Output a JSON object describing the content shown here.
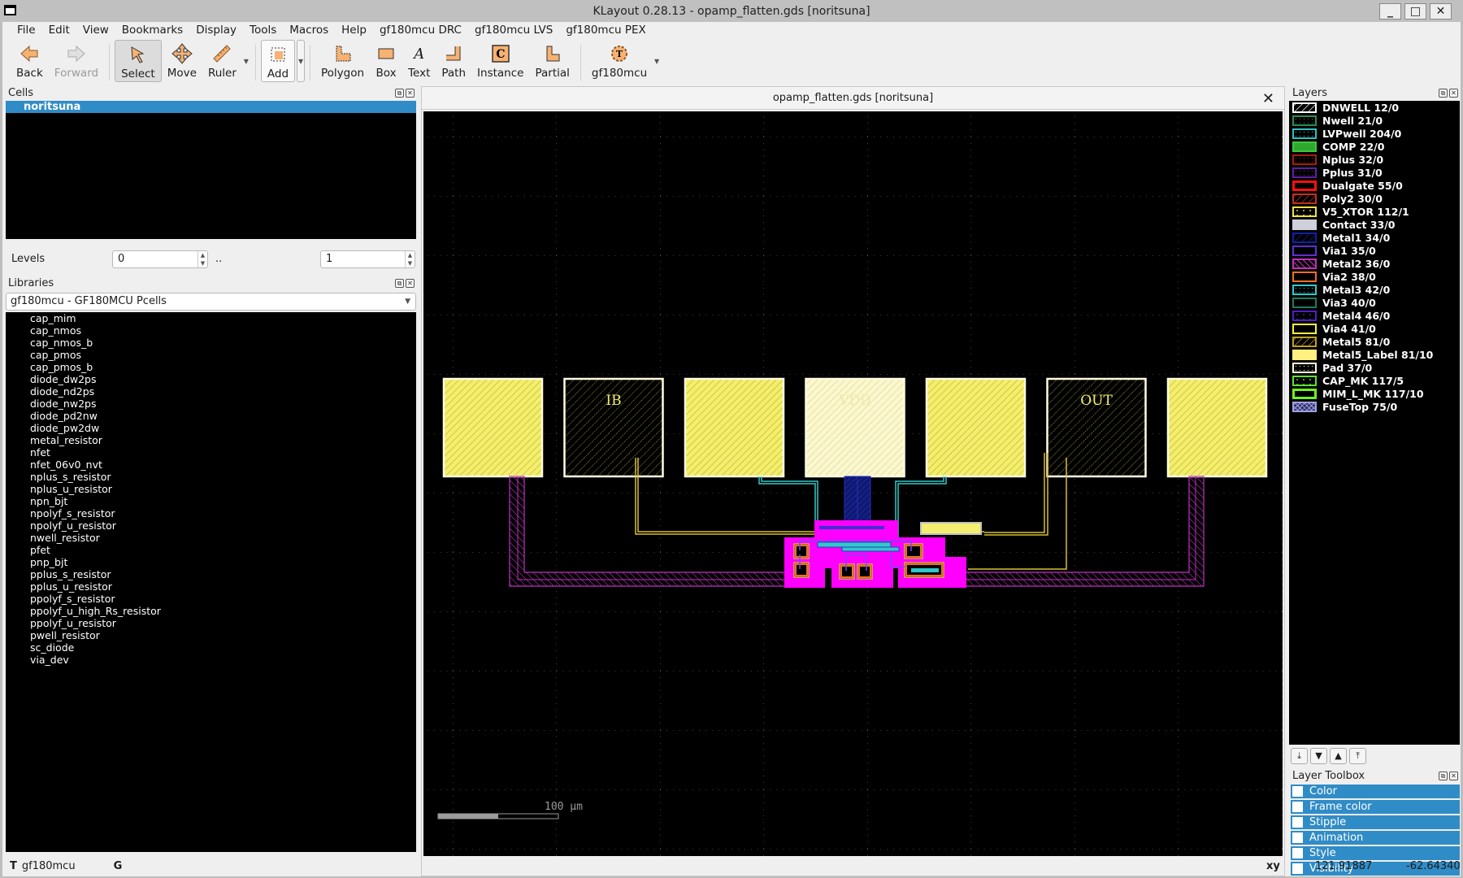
{
  "window": {
    "title": "KLayout 0.28.13 - opamp_flatten.gds [noritsuna]",
    "buttons": [
      "minimize",
      "maximize",
      "close"
    ]
  },
  "menu": [
    "File",
    "Edit",
    "View",
    "Bookmarks",
    "Display",
    "Tools",
    "Macros",
    "Help",
    "gf180mcu DRC",
    "gf180mcu LVS",
    "gf180mcu PEX"
  ],
  "toolbar": {
    "back": "Back",
    "forward": "Forward",
    "select": "Select",
    "move": "Move",
    "ruler": "Ruler",
    "add": "Add",
    "polygon": "Polygon",
    "box": "Box",
    "text": "Text",
    "path": "Path",
    "instance": "Instance",
    "partial": "Partial",
    "tech": "gf180mcu"
  },
  "cells": {
    "title": "Cells",
    "items": [
      "noritsuna"
    ],
    "selected": "noritsuna"
  },
  "levels": {
    "label": "Levels",
    "from": "0",
    "separator": "..",
    "to": "1"
  },
  "libraries": {
    "title": "Libraries",
    "selected": "gf180mcu - GF180MCU Pcells",
    "items": [
      "cap_mim",
      "cap_nmos",
      "cap_nmos_b",
      "cap_pmos",
      "cap_pmos_b",
      "diode_dw2ps",
      "diode_nd2ps",
      "diode_nw2ps",
      "diode_pd2nw",
      "diode_pw2dw",
      "metal_resistor",
      "nfet",
      "nfet_06v0_nvt",
      "nplus_s_resistor",
      "nplus_u_resistor",
      "npn_bjt",
      "npolyf_s_resistor",
      "npolyf_u_resistor",
      "nwell_resistor",
      "pfet",
      "pnp_bjt",
      "pplus_s_resistor",
      "pplus_u_resistor",
      "ppolyf_s_resistor",
      "ppolyf_u_high_Rs_resistor",
      "ppolyf_u_resistor",
      "pwell_resistor",
      "sc_diode",
      "via_dev"
    ]
  },
  "view": {
    "tab_title": "opamp_flatten.gds [noritsuna]",
    "scale_label": "100 µm",
    "pad_labels": [
      "",
      "IB",
      "",
      "VDD",
      "",
      "OUT",
      ""
    ]
  },
  "layers": {
    "title": "Layers",
    "items": [
      {
        "name": "DNWELL 12/0",
        "color": "#ffffff",
        "fill": "none",
        "pattern": "diag"
      },
      {
        "name": "Nwell 21/0",
        "color": "#2e8b57",
        "fill": "none",
        "pattern": "dots"
      },
      {
        "name": "LVPwell 204/0",
        "color": "#30c0c0",
        "fill": "none",
        "pattern": "dots"
      },
      {
        "name": "COMP 22/0",
        "color": "#3cc83c",
        "fill": "#2fa82f",
        "pattern": "solid"
      },
      {
        "name": "Nplus 32/0",
        "color": "#a02010",
        "fill": "none",
        "pattern": "dots"
      },
      {
        "name": "Pplus 31/0",
        "color": "#6020a0",
        "fill": "none",
        "pattern": "dots"
      },
      {
        "name": "Dualgate 55/0",
        "color": "#ff1010",
        "fill": "none",
        "pattern": "thick"
      },
      {
        "name": "Poly2 30/0",
        "color": "#c03020",
        "fill": "none",
        "pattern": "diag"
      },
      {
        "name": "V5_XTOR 112/1",
        "color": "#f0e040",
        "fill": "none",
        "pattern": "plus"
      },
      {
        "name": "Contact 33/0",
        "color": "#d0d0dc",
        "fill": "#d0d0dc",
        "pattern": "solid"
      },
      {
        "name": "Metal1 34/0",
        "color": "#1020a0",
        "fill": "none",
        "pattern": "diag"
      },
      {
        "name": "Via1 35/0",
        "color": "#6030d0",
        "fill": "none",
        "pattern": "none"
      },
      {
        "name": "Metal2 36/0",
        "color": "#c030c0",
        "fill": "none",
        "pattern": "back"
      },
      {
        "name": "Via2 38/0",
        "color": "#f07020",
        "fill": "none",
        "pattern": "none"
      },
      {
        "name": "Metal3 42/0",
        "color": "#30c8c8",
        "fill": "none",
        "pattern": "dots"
      },
      {
        "name": "Via3 40/0",
        "color": "#207860",
        "fill": "none",
        "pattern": "none"
      },
      {
        "name": "Metal4 46/0",
        "color": "#5020c0",
        "fill": "none",
        "pattern": "plus"
      },
      {
        "name": "Via4 41/0",
        "color": "#f8f040",
        "fill": "none",
        "pattern": "none"
      },
      {
        "name": "Metal5 81/0",
        "color": "#c0a020",
        "fill": "none",
        "pattern": "diag"
      },
      {
        "name": "Metal5_Label 81/10",
        "color": "#fff080",
        "fill": "#fff080",
        "pattern": "solid"
      },
      {
        "name": "Pad 37/0",
        "color": "#fffbe0",
        "fill": "none",
        "pattern": "dots"
      },
      {
        "name": "CAP_MK 117/5",
        "color": "#60e030",
        "fill": "none",
        "pattern": "plus"
      },
      {
        "name": "MIM_L_MK 117/10",
        "color": "#70f020",
        "fill": "none",
        "pattern": "thick"
      },
      {
        "name": "FuseTop 75/0",
        "color": "#a0a0e8",
        "fill": "none",
        "pattern": "cross"
      }
    ],
    "buttons": [
      "move-to-bottom",
      "move-down",
      "move-up",
      "move-to-top"
    ]
  },
  "layer_toolbox": {
    "title": "Layer Toolbox",
    "items": [
      "Color",
      "Frame color",
      "Stipple",
      "Animation",
      "Style",
      "Visibility"
    ]
  },
  "status": {
    "mode_key": "T",
    "tech": "gf180mcu",
    "grid_key": "G",
    "coord_label": "xy",
    "x": "121.91887",
    "y": "-62.64340"
  },
  "colors": {
    "selection": "#308cc6",
    "canvas_bg": "#000000",
    "metal5_label": "#fff080",
    "metal2": "#c030c0",
    "metal3": "#30c8c8",
    "dualgate": "#ff00ff"
  }
}
